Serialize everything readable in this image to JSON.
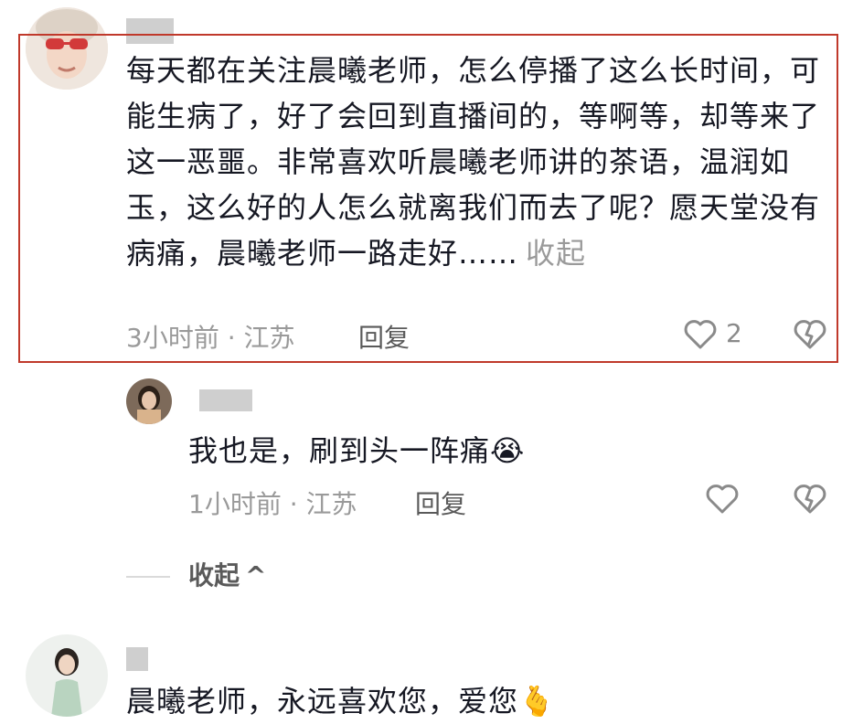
{
  "comment_main": {
    "text": "每天都在关注晨曦老师，怎么停播了这么长时间，可能生病了，好了会回到直播间的，等啊等，却等来了这一恶噩。非常喜欢听晨曦老师讲的茶语，温润如玉，这么好的人怎么就离我们而去了呢？愿天堂没有病痛，晨曦老师一路走好……",
    "collapse_label": "收起",
    "time_location": "3小时前 · 江苏",
    "reply_label": "回复",
    "like_count": "2"
  },
  "reply": {
    "text": "我也是，刷到头一阵痛",
    "emoji": "😭",
    "time_location": "1小时前 · 江苏",
    "reply_label": "回复"
  },
  "collapse_replies": {
    "label": "收起",
    "chevron": "^"
  },
  "comment_third": {
    "text": "晨曦老师，永远喜欢您，爱您",
    "emoji": "🫰"
  },
  "icons": {
    "like": "heart-outline-icon",
    "dislike": "broken-heart-icon"
  },
  "colors": {
    "highlight_border": "#c0392b",
    "text": "#161823",
    "meta": "#9a9a9a"
  }
}
